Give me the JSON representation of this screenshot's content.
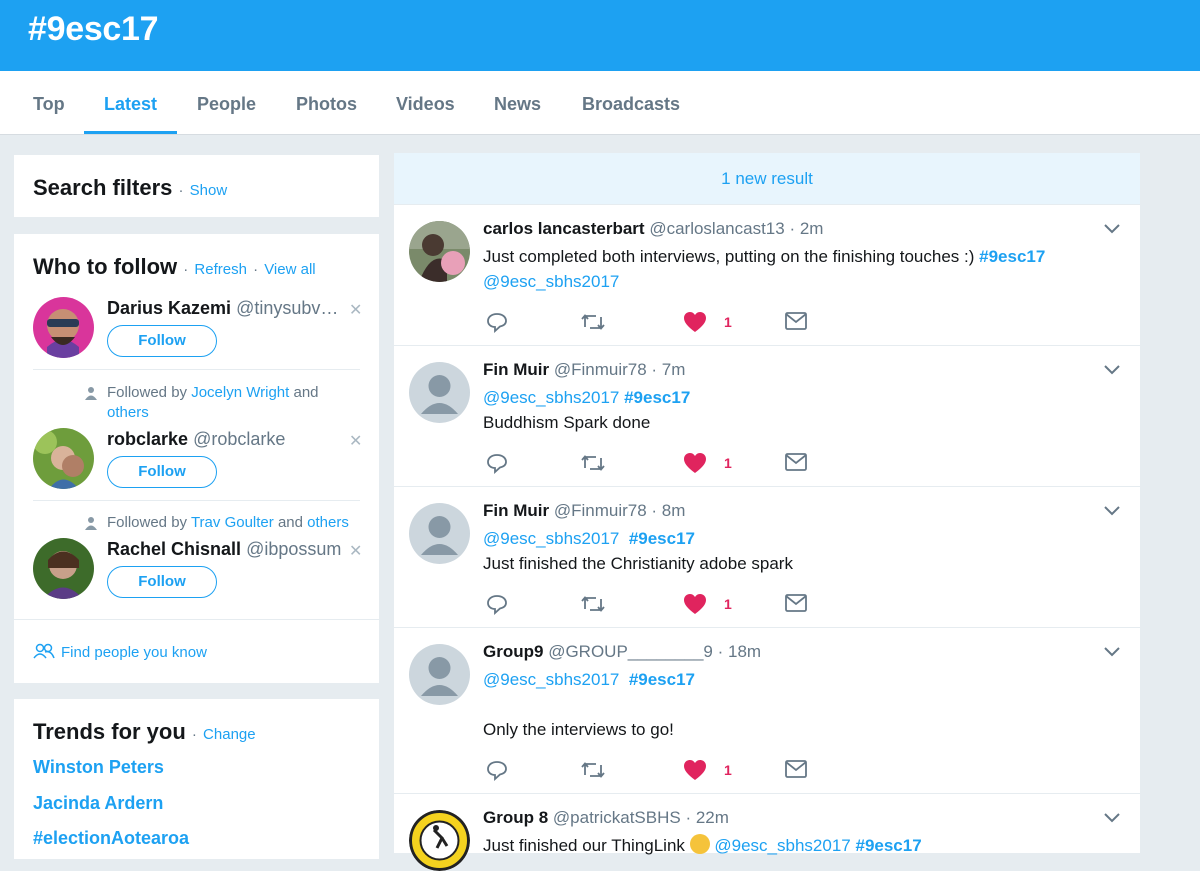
{
  "header": {
    "title": "#9esc17"
  },
  "tabs": [
    "Top",
    "Latest",
    "People",
    "Photos",
    "Videos",
    "News",
    "Broadcasts"
  ],
  "search_filters": {
    "title": "Search filters",
    "show_link": "Show"
  },
  "who_to_follow": {
    "title": "Who to follow",
    "refresh": "Refresh",
    "view_all": "View all",
    "follow_label": "Follow",
    "users": [
      {
        "name": "Darius Kazemi",
        "handle": "@tinysubv…",
        "followed_by": null
      },
      {
        "name": "robclarke",
        "handle": "@robclarke",
        "followed_by_prefix": "Followed by",
        "followed_by_link": "Jocelyn Wright",
        "followed_by_mid": "and",
        "followed_by_end": "others"
      },
      {
        "name": "Rachel Chisnall",
        "handle": "@ibpossum",
        "followed_by_prefix": "Followed by",
        "followed_by_link": "Trav Goulter",
        "followed_by_mid": "and",
        "followed_by_end": "others"
      }
    ],
    "find_people": "Find people you know"
  },
  "trends": {
    "title": "Trends for you",
    "change": "Change",
    "items": [
      "Winston Peters",
      "Jacinda Ardern",
      "#electionAotearoa"
    ]
  },
  "stream": {
    "new_result": "1 new result",
    "tweets": [
      {
        "name": "carlos lancasterbart",
        "handle": "@carloslancast13",
        "time": "· 2m",
        "text": "Just completed both interviews, putting on the finishing touches :)",
        "tag1": "#9esc17",
        "mention": "@9esc_sbhs2017",
        "likes": "1"
      },
      {
        "name": "Fin Muir",
        "handle": "@Finmuir78",
        "time": "· 7m",
        "mention": "@9esc_sbhs2017",
        "tag1": "#9esc17",
        "text": "Buddhism Spark done",
        "likes": "1"
      },
      {
        "name": "Fin Muir",
        "handle": "@Finmuir78",
        "time": "· 8m",
        "mention": "@9esc_sbhs2017",
        "tag1": "#9esc17",
        "text": "Just finished the Christianity adobe spark",
        "likes": "1"
      },
      {
        "name": "Group9",
        "handle": "@GROUP________9",
        "time": "· 18m",
        "mention": "@9esc_sbhs2017",
        "tag1": "#9esc17",
        "text": "Only the interviews to go!",
        "likes": "1"
      },
      {
        "name": "Group 8",
        "handle": "@patrickatSBHS",
        "time": "· 22m",
        "text": "Just finished our ThingLink",
        "mention": "@9esc_sbhs2017",
        "tag1": "#9esc17"
      }
    ]
  },
  "colors": {
    "brand": "#1da1f2",
    "like": "#e0245e",
    "muted": "#657786"
  },
  "icons": [
    "reply-icon",
    "retweet-icon",
    "heart-icon",
    "dm-icon",
    "chevron-down-icon",
    "person-icon",
    "people-icon",
    "close-icon"
  ]
}
